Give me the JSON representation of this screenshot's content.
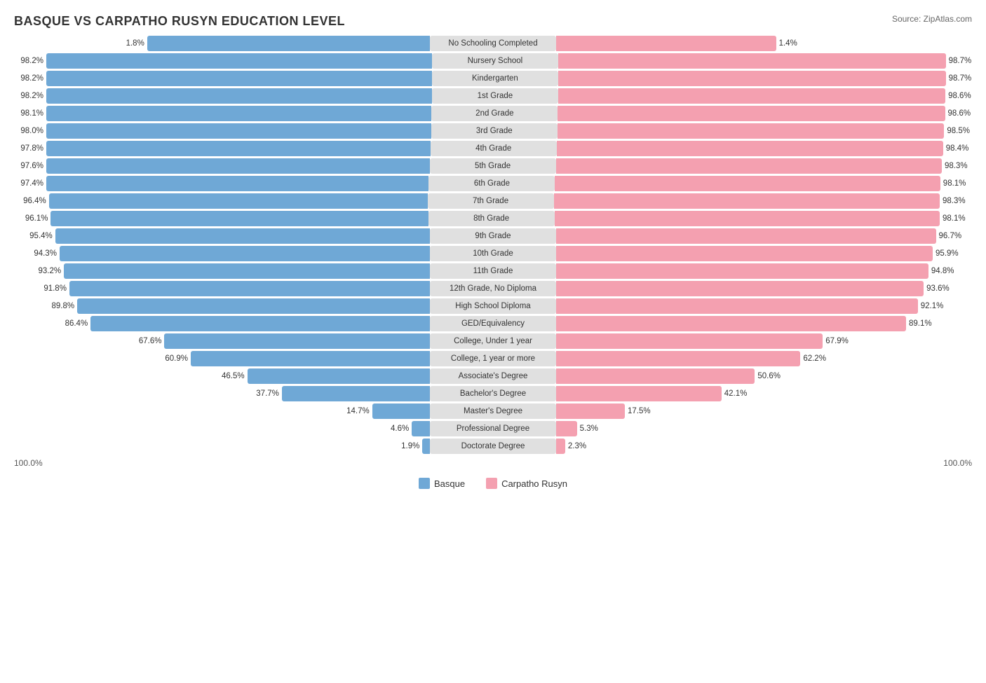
{
  "title": "BASQUE VS CARPATHO RUSYN EDUCATION LEVEL",
  "source": "Source: ZipAtlas.com",
  "colors": {
    "blue": "#6fa8d6",
    "pink": "#f4a0b0",
    "label_bg": "#e0e0e0"
  },
  "legend": {
    "basque_label": "Basque",
    "carpatho_label": "Carpatho Rusyn"
  },
  "axis": {
    "left": "100.0%",
    "right": "100.0%"
  },
  "rows": [
    {
      "label": "No Schooling Completed",
      "basque": 1.8,
      "carpatho": 1.4,
      "basque_pct": "1.8%",
      "carpatho_pct": "1.4%",
      "max": 2.0
    },
    {
      "label": "Nursery School",
      "basque": 98.2,
      "carpatho": 98.7,
      "basque_pct": "98.2%",
      "carpatho_pct": "98.7%",
      "max": 100
    },
    {
      "label": "Kindergarten",
      "basque": 98.2,
      "carpatho": 98.7,
      "basque_pct": "98.2%",
      "carpatho_pct": "98.7%",
      "max": 100
    },
    {
      "label": "1st Grade",
      "basque": 98.2,
      "carpatho": 98.6,
      "basque_pct": "98.2%",
      "carpatho_pct": "98.6%",
      "max": 100
    },
    {
      "label": "2nd Grade",
      "basque": 98.1,
      "carpatho": 98.6,
      "basque_pct": "98.1%",
      "carpatho_pct": "98.6%",
      "max": 100
    },
    {
      "label": "3rd Grade",
      "basque": 98.0,
      "carpatho": 98.5,
      "basque_pct": "98.0%",
      "carpatho_pct": "98.5%",
      "max": 100
    },
    {
      "label": "4th Grade",
      "basque": 97.8,
      "carpatho": 98.4,
      "basque_pct": "97.8%",
      "carpatho_pct": "98.4%",
      "max": 100
    },
    {
      "label": "5th Grade",
      "basque": 97.6,
      "carpatho": 98.3,
      "basque_pct": "97.6%",
      "carpatho_pct": "98.3%",
      "max": 100
    },
    {
      "label": "6th Grade",
      "basque": 97.4,
      "carpatho": 98.1,
      "basque_pct": "97.4%",
      "carpatho_pct": "98.1%",
      "max": 100
    },
    {
      "label": "7th Grade",
      "basque": 96.4,
      "carpatho": 98.3,
      "basque_pct": "96.4%",
      "carpatho_pct": "98.3%",
      "max": 100
    },
    {
      "label": "8th Grade",
      "basque": 96.1,
      "carpatho": 98.1,
      "basque_pct": "96.1%",
      "carpatho_pct": "98.1%",
      "max": 100
    },
    {
      "label": "9th Grade",
      "basque": 95.4,
      "carpatho": 96.7,
      "basque_pct": "95.4%",
      "carpatho_pct": "96.7%",
      "max": 100
    },
    {
      "label": "10th Grade",
      "basque": 94.3,
      "carpatho": 95.9,
      "basque_pct": "94.3%",
      "carpatho_pct": "95.9%",
      "max": 100
    },
    {
      "label": "11th Grade",
      "basque": 93.2,
      "carpatho": 94.8,
      "basque_pct": "93.2%",
      "carpatho_pct": "94.8%",
      "max": 100
    },
    {
      "label": "12th Grade, No Diploma",
      "basque": 91.8,
      "carpatho": 93.6,
      "basque_pct": "91.8%",
      "carpatho_pct": "93.6%",
      "max": 100
    },
    {
      "label": "High School Diploma",
      "basque": 89.8,
      "carpatho": 92.1,
      "basque_pct": "89.8%",
      "carpatho_pct": "92.1%",
      "max": 100
    },
    {
      "label": "GED/Equivalency",
      "basque": 86.4,
      "carpatho": 89.1,
      "basque_pct": "86.4%",
      "carpatho_pct": "89.1%",
      "max": 100
    },
    {
      "label": "College, Under 1 year",
      "basque": 67.6,
      "carpatho": 67.9,
      "basque_pct": "67.6%",
      "carpatho_pct": "67.9%",
      "max": 100
    },
    {
      "label": "College, 1 year or more",
      "basque": 60.9,
      "carpatho": 62.2,
      "basque_pct": "60.9%",
      "carpatho_pct": "62.2%",
      "max": 100
    },
    {
      "label": "Associate's Degree",
      "basque": 46.5,
      "carpatho": 50.6,
      "basque_pct": "46.5%",
      "carpatho_pct": "50.6%",
      "max": 100
    },
    {
      "label": "Bachelor's Degree",
      "basque": 37.7,
      "carpatho": 42.1,
      "basque_pct": "37.7%",
      "carpatho_pct": "42.1%",
      "max": 100
    },
    {
      "label": "Master's Degree",
      "basque": 14.7,
      "carpatho": 17.5,
      "basque_pct": "14.7%",
      "carpatho_pct": "17.5%",
      "max": 100
    },
    {
      "label": "Professional Degree",
      "basque": 4.6,
      "carpatho": 5.3,
      "basque_pct": "4.6%",
      "carpatho_pct": "5.3%",
      "max": 100
    },
    {
      "label": "Doctorate Degree",
      "basque": 1.9,
      "carpatho": 2.3,
      "basque_pct": "1.9%",
      "carpatho_pct": "2.3%",
      "max": 100
    }
  ]
}
